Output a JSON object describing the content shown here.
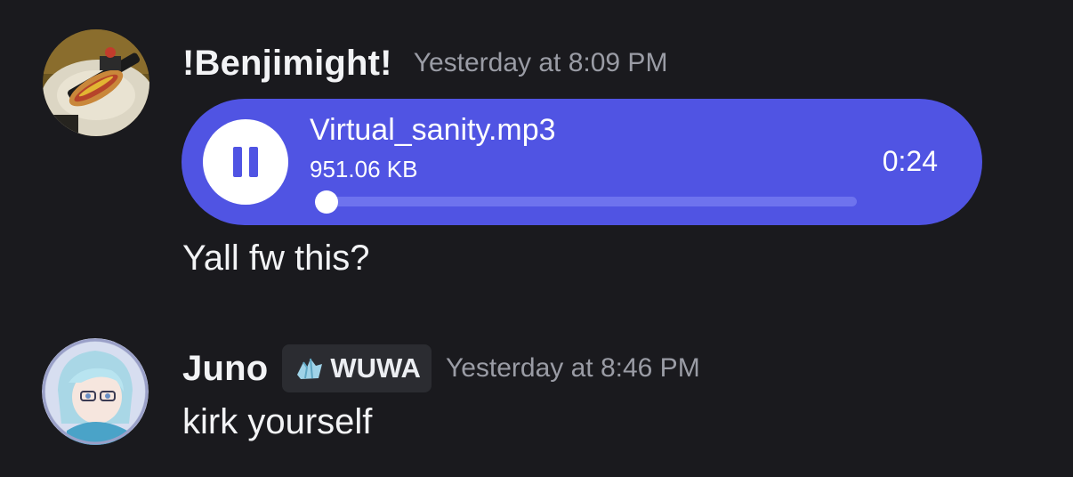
{
  "messages": [
    {
      "username": "!Benjimight!",
      "timestamp": "Yesterday at 8:09 PM",
      "avatar": "hot-dog-photo-avatar",
      "attachment": {
        "type": "audio",
        "file_name": "Virtual_sanity.mp3",
        "file_size": "951.06 KB",
        "duration": "0:24",
        "state": "playing",
        "control_icon": "pause-icon",
        "progress": 0.02
      },
      "text": "Yall fw this?"
    },
    {
      "username": "Juno",
      "tag": {
        "icon": "crystal-icon",
        "label": "WUWA"
      },
      "timestamp": "Yesterday at 8:46 PM",
      "avatar": "anime-character-avatar",
      "text": "kirk yourself"
    }
  ],
  "colors": {
    "background": "#1a1a1e",
    "audio_player": "#5054e3",
    "timestamp": "#9a9ca5",
    "tag_background": "#2b2c31"
  }
}
